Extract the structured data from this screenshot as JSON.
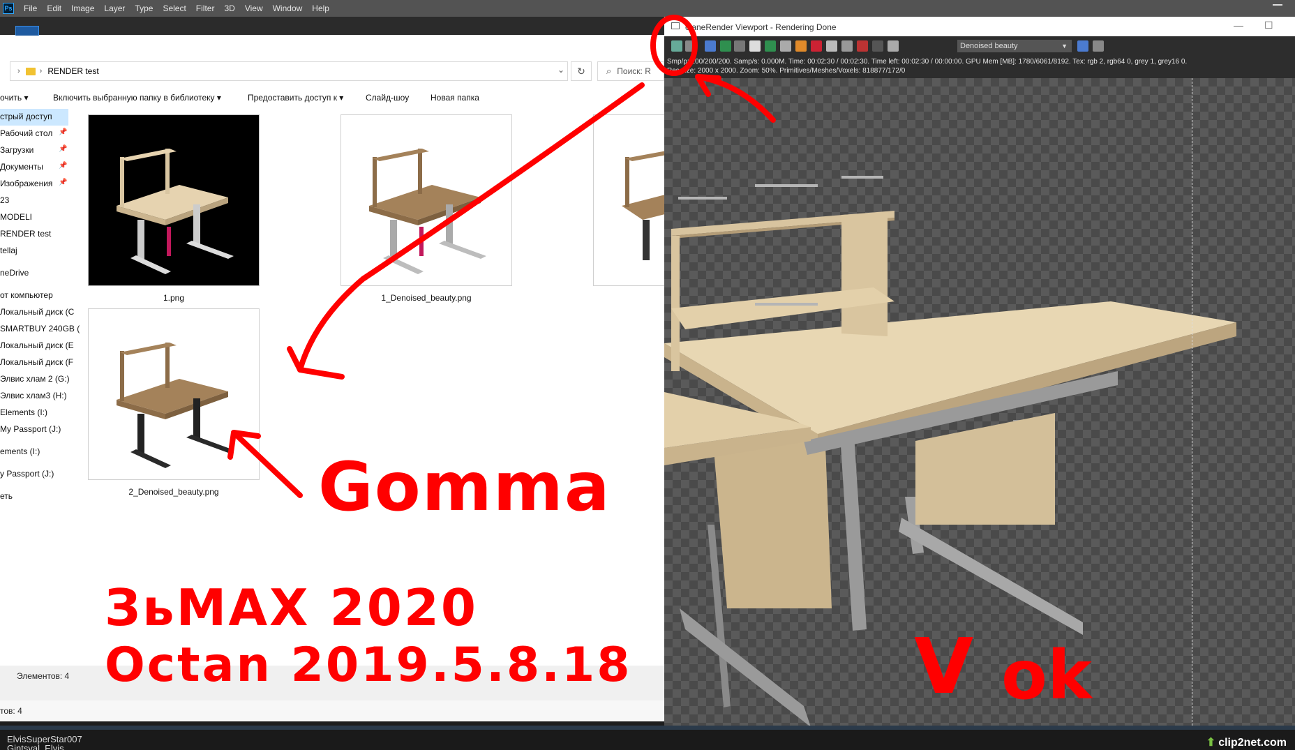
{
  "photoshop": {
    "logo": "Ps",
    "menu": [
      "File",
      "Edit",
      "Image",
      "Layer",
      "Type",
      "Select",
      "Filter",
      "3D",
      "View",
      "Window",
      "Help"
    ]
  },
  "explorer": {
    "path": "RENDER test",
    "search_placeholder": "Поиск: R",
    "commands": [
      "очить",
      "Включить выбранную папку в библиотеку",
      "Предоставить доступ к",
      "Слайд-шоу",
      "Новая папка"
    ],
    "nav": [
      "стрый доступ",
      "Рабочий стол",
      "Загрузки",
      "Документы",
      "Изображения",
      "23",
      "MODELI",
      "RENDER test",
      "tellaj",
      "neDrive",
      "от компьютер",
      "Локальный диск (C",
      "SMARTBUY 240GB (",
      "Локальный диск (E",
      "Локальный диск (F",
      "Элвис хлам 2 (G:)",
      "Элвис хлам3 (H:)",
      "Elements (I:)",
      "My Passport (J:)",
      "ements (I:)",
      "y Passport (J:)",
      "еть"
    ],
    "files": [
      {
        "name": "1.png"
      },
      {
        "name": "1_Denoised_beauty.png"
      },
      {
        "name": "2_Denoised_beauty.png"
      }
    ],
    "status_count": "Элементов: 4",
    "status_bottom": "тов: 4"
  },
  "octane": {
    "title": "OctaneRender Viewport - Rendering Done",
    "title_visible": "ctaneRender Viewport - Rendering Done",
    "min": "—",
    "max": "☐",
    "pass_select": "Denoised beauty",
    "info_line1": "Smp/p: 200/200/200.   Samp/s: 0.000M.   Time: 00:02:30 / 00:02:30.   Time left: 00:02:30 / 00:00:00.   GPU Mem [MB]: 1780/6061/8192.   Tex: rgb 2, rgb64 0, grey 1, grey16 0.",
    "info_line2": "Res size: 2000 x 2000.   Zoom: 50%.   Primitives/Meshes/Voxels: 818877/172/0"
  },
  "annotations": {
    "gamma": "Gomma",
    "line1": "ЗьМАХ  2020",
    "line2": "Octan  2019.5.8.18",
    "check": "V",
    "ok": "ok",
    "color": "#ff0000"
  },
  "taskbar": {
    "user1": "ElvisSuperStar007",
    "user2": "Gintsval, Elvis",
    "brand": "clip2net.com"
  }
}
